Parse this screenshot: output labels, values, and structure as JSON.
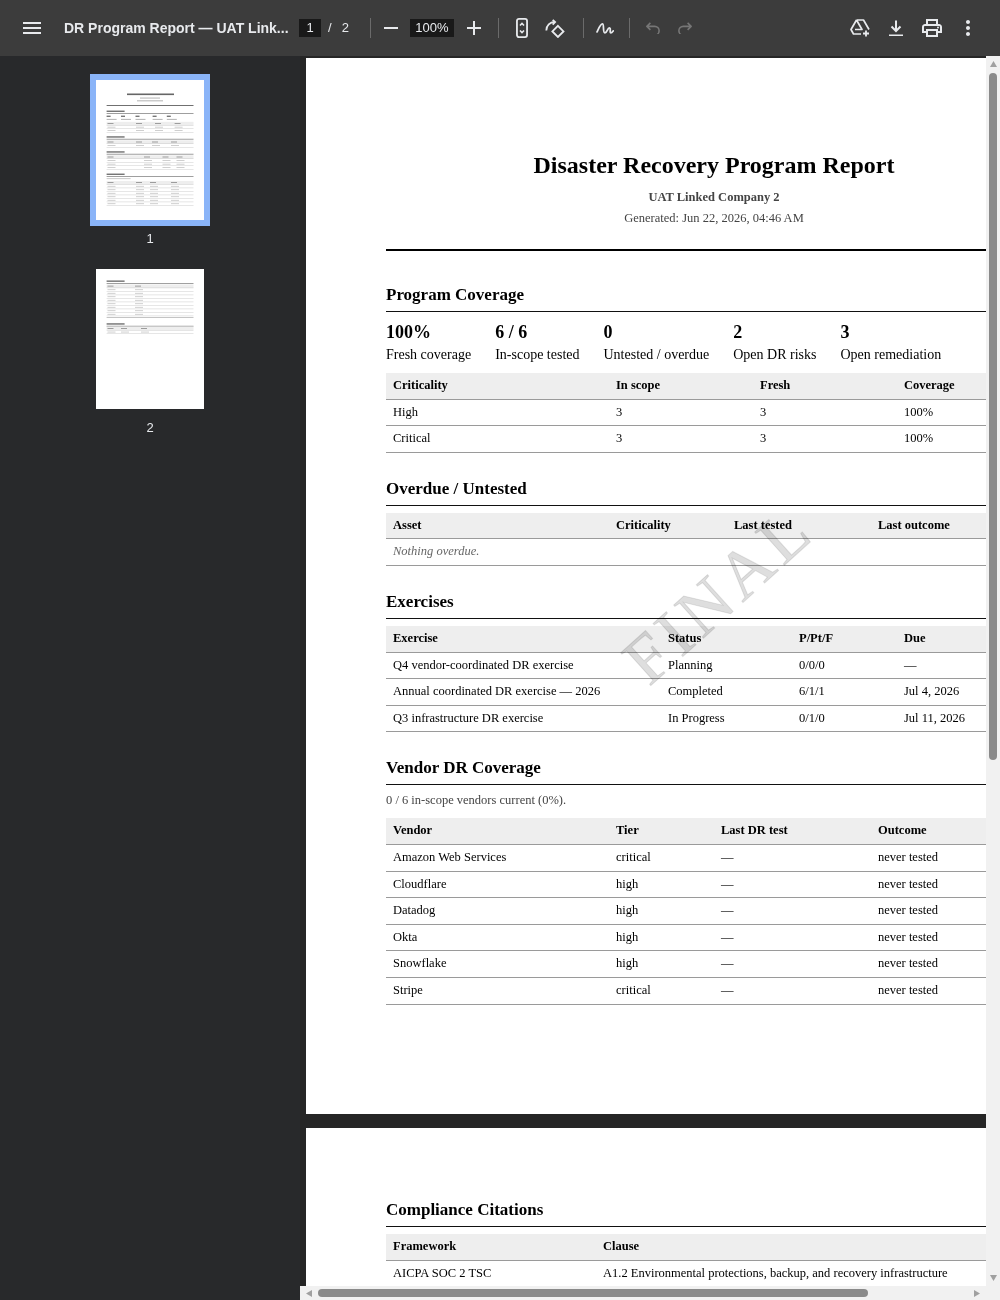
{
  "toolbar": {
    "title": "DR Program Report — UAT Link...",
    "page_field": "1",
    "page_separator": "/",
    "page_count": "2",
    "zoom_field": "100%",
    "undo": {
      "disabled": true
    },
    "redo": {
      "disabled": true
    }
  },
  "thumbnails": [
    {
      "label": "1",
      "selected": true
    },
    {
      "label": "2",
      "selected": false
    }
  ],
  "pages": [
    {
      "watermark": "FINAL",
      "header": {
        "title": "Disaster Recovery Program Report",
        "company": "UAT Linked Company 2",
        "generated": "Generated: Jun 22, 2026, 04:46 AM"
      },
      "sections": [
        {
          "heading": "Program Coverage",
          "stats": [
            {
              "value": "100%",
              "label": "Fresh coverage"
            },
            {
              "value": "6 / 6",
              "label": "In-scope tested"
            },
            {
              "value": "0",
              "label": "Untested / overdue"
            },
            {
              "value": "2",
              "label": "Open DR risks"
            },
            {
              "value": "3",
              "label": "Open remediation"
            }
          ],
          "table": {
            "columns": [
              "Criticality",
              "In scope",
              "Fresh",
              "Coverage"
            ],
            "rows": [
              [
                "High",
                "3",
                "3",
                "100%"
              ],
              [
                "Critical",
                "3",
                "3",
                "100%"
              ]
            ]
          }
        },
        {
          "heading": "Overdue / Untested",
          "table": {
            "columns": [
              "Asset",
              "Criticality",
              "Last tested",
              "Last outcome"
            ],
            "empty_text": "Nothing overdue."
          }
        },
        {
          "heading": "Exercises",
          "table": {
            "columns": [
              "Exercise",
              "Status",
              "P/Pt/F",
              "Due"
            ],
            "rows": [
              [
                "Q4 vendor-coordinated DR exercise",
                "Planning",
                "0/0/0",
                "—"
              ],
              [
                "Annual coordinated DR exercise — 2026",
                "Completed",
                "6/1/1",
                "Jul 4, 2026"
              ],
              [
                "Q3 infrastructure DR exercise",
                "In Progress",
                "0/1/0",
                "Jul 11, 2026"
              ]
            ]
          }
        },
        {
          "heading": "Vendor DR Coverage",
          "note": "0 / 6 in-scope vendors current (0%).",
          "table": {
            "columns": [
              "Vendor",
              "Tier",
              "Last DR test",
              "Outcome"
            ],
            "rows": [
              [
                "Amazon Web Services",
                "critical",
                "—",
                "never tested"
              ],
              [
                "Cloudflare",
                "high",
                "—",
                "never tested"
              ],
              [
                "Datadog",
                "high",
                "—",
                "never tested"
              ],
              [
                "Okta",
                "high",
                "—",
                "never tested"
              ],
              [
                "Snowflake",
                "high",
                "—",
                "never tested"
              ],
              [
                "Stripe",
                "critical",
                "—",
                "never tested"
              ]
            ]
          }
        }
      ]
    },
    {
      "sections": [
        {
          "heading": "Compliance Citations",
          "table": {
            "columns": [
              "Framework",
              "Clause"
            ],
            "rows": [
              [
                "AICPA SOC 2 TSC",
                "A1.2 Environmental protections, backup, and recovery infrastructure"
              ]
            ]
          }
        }
      ]
    }
  ]
}
